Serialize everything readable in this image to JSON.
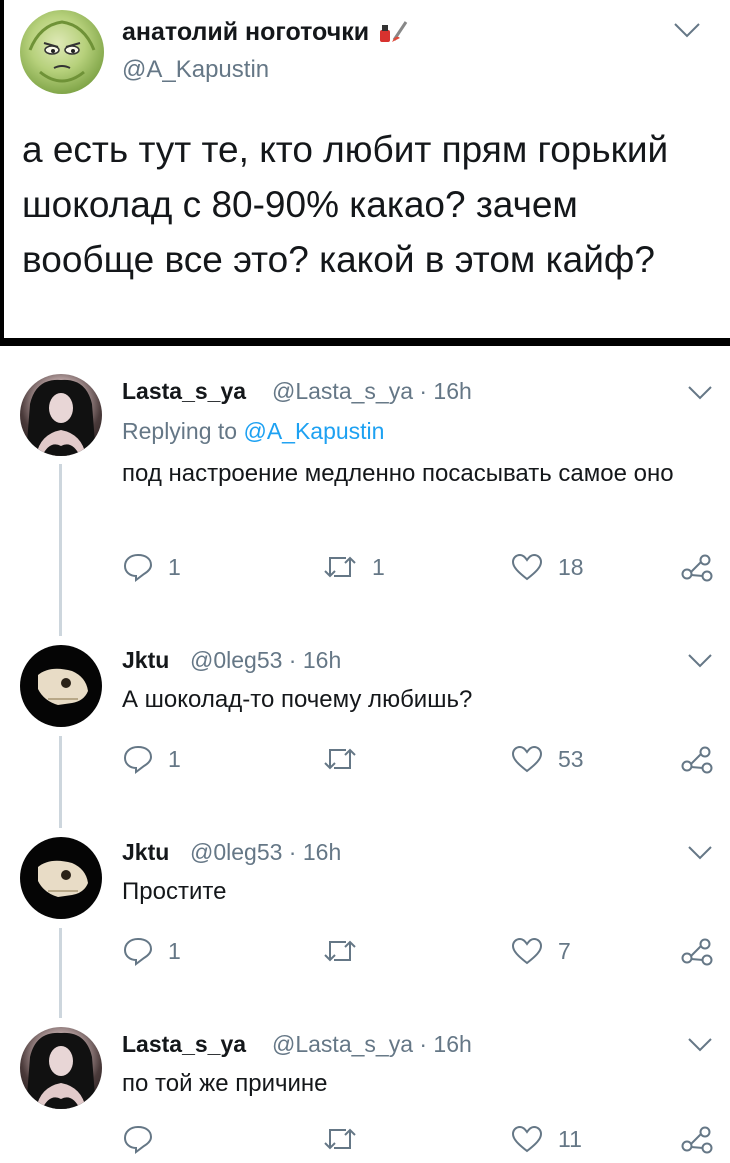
{
  "main_tweet": {
    "name": "анатолий ноготочки",
    "handle": "@A_Kapustin",
    "text": "а есть тут те, кто любит прям горький шоколад с 80-90% какао? зачем вообще все это? какой в этом кайф?"
  },
  "replies": [
    {
      "name": "Lasta_s_ya",
      "meta": "@Lasta_s_ya · 16h",
      "replying_label": "Replying to",
      "replying_handle": "@A_Kapustin",
      "text": "под настроение медленно посасывать самое оно",
      "reply_count": "1",
      "retweet_count": "1",
      "like_count": "18"
    },
    {
      "name": "Jktu",
      "meta": "@0leg53 · 16h",
      "text": "А шоколад-то почему любишь?",
      "reply_count": "1",
      "retweet_count": "",
      "like_count": "53"
    },
    {
      "name": "Jktu",
      "meta": "@0leg53 · 16h",
      "text": "Простите",
      "reply_count": "1",
      "retweet_count": "",
      "like_count": "7"
    },
    {
      "name": "Lasta_s_ya",
      "meta": "@Lasta_s_ya · 16h",
      "text": "по той же причине",
      "reply_count": "",
      "retweet_count": "",
      "like_count": "11"
    }
  ],
  "colors": {
    "text": "#14171a",
    "secondary": "#657786",
    "link": "#1da1f2",
    "thread_line": "#cdd6dd"
  },
  "icons": {
    "reply": "reply-icon",
    "retweet": "retweet-icon",
    "like": "heart-icon",
    "share": "share-icon",
    "more": "chevron-down-icon"
  }
}
